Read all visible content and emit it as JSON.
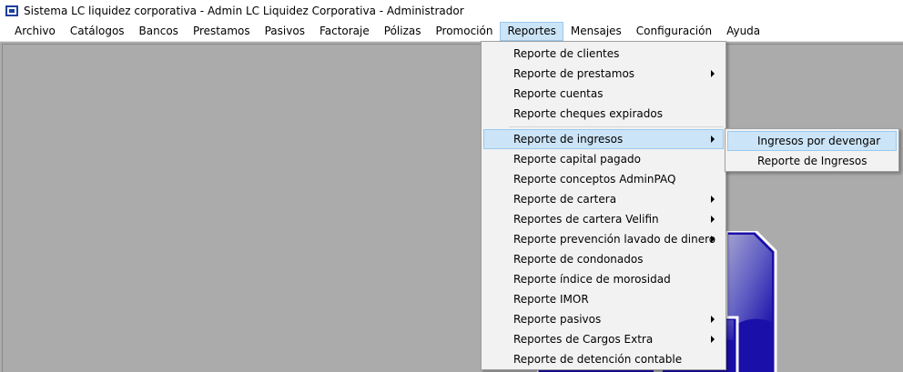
{
  "window": {
    "title": "Sistema LC liquidez corporativa - Admin LC Liquidez Corporativa - Administrador",
    "icon": "app-logo-icon"
  },
  "menubar": {
    "items": [
      {
        "label": "Archivo"
      },
      {
        "label": "Catálogos"
      },
      {
        "label": "Bancos"
      },
      {
        "label": "Prestamos"
      },
      {
        "label": "Pasivos"
      },
      {
        "label": "Factoraje"
      },
      {
        "label": "Pólizas"
      },
      {
        "label": "Promoción"
      },
      {
        "label": "Reportes",
        "active": true
      },
      {
        "label": "Mensajes"
      },
      {
        "label": "Configuración"
      },
      {
        "label": "Ayuda"
      }
    ]
  },
  "reportes_menu": {
    "items": [
      {
        "label": "Reporte de clientes",
        "submenu": false
      },
      {
        "label": "Reporte de prestamos",
        "submenu": true
      },
      {
        "label": "Reporte cuentas",
        "submenu": false
      },
      {
        "label": "Reporte cheques expirados",
        "submenu": false
      },
      {
        "label": "Reporte de ingresos",
        "submenu": true,
        "highlighted": true
      },
      {
        "label": "Reporte capital pagado",
        "submenu": false
      },
      {
        "label": "Reporte conceptos AdminPAQ",
        "submenu": false
      },
      {
        "label": "Reporte de cartera",
        "submenu": true
      },
      {
        "label": "Reportes de cartera Velifin",
        "submenu": true
      },
      {
        "label": "Reporte prevención lavado de dinero",
        "submenu": true
      },
      {
        "label": "Reporte de condonados",
        "submenu": false
      },
      {
        "label": "Reporte índice de morosidad",
        "submenu": false
      },
      {
        "label": "Reporte IMOR",
        "submenu": false
      },
      {
        "label": "Reporte pasivos",
        "submenu": true
      },
      {
        "label": "Reportes de Cargos Extra",
        "submenu": true
      },
      {
        "label": "Reporte de detención contable",
        "submenu": false
      }
    ]
  },
  "ingresos_submenu": {
    "items": [
      {
        "label": "Ingresos por devengar",
        "highlighted": true
      },
      {
        "label": "Reporte de Ingresos"
      }
    ]
  },
  "colors": {
    "workspace": "#ababab",
    "highlight": "#cce4f7",
    "highlight_border": "#99c9ef",
    "logo_blue": "#1a0fa8"
  }
}
